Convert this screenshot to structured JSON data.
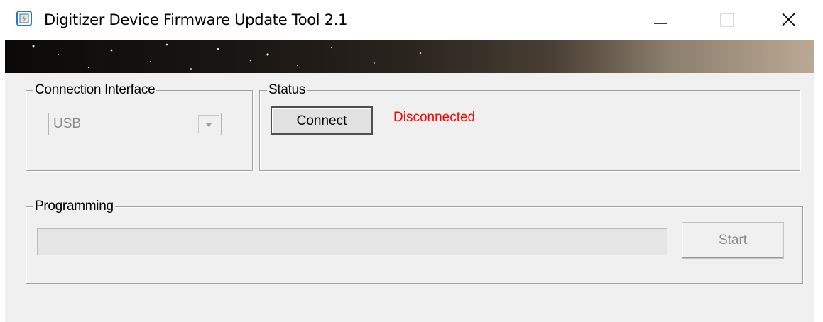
{
  "window": {
    "title": "Digitizer Device Firmware Update Tool 2.1",
    "app_icon": "firmware-chip-icon"
  },
  "connection_interface": {
    "label": "Connection Interface",
    "selected": "USB"
  },
  "status": {
    "label": "Status",
    "connect_label": "Connect",
    "state_text": "Disconnected",
    "state_color": "#ff0000"
  },
  "programming": {
    "label": "Programming",
    "progress": 0,
    "start_label": "Start"
  }
}
